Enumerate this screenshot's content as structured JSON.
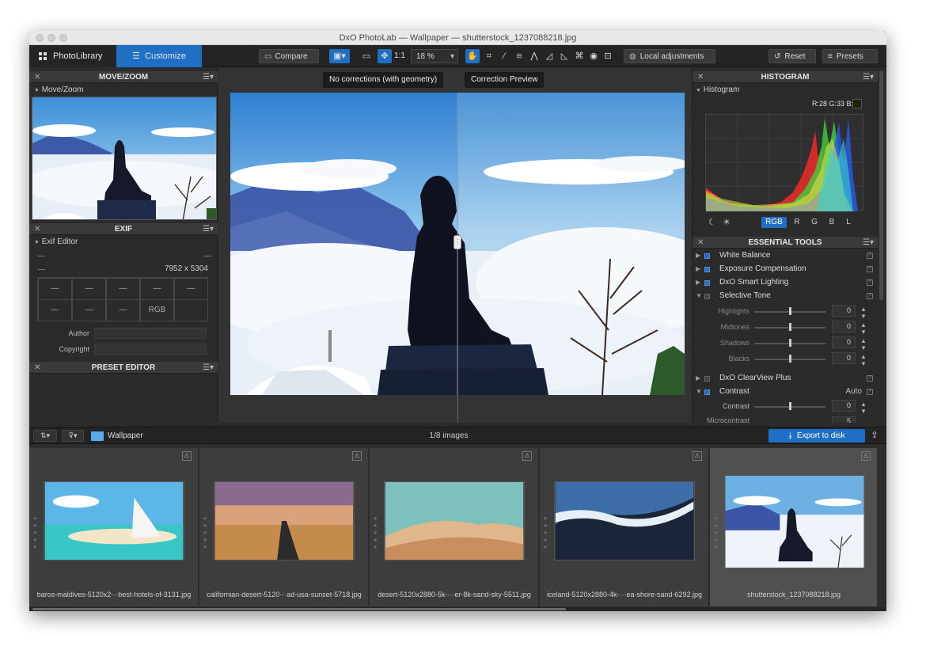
{
  "window": {
    "title": "DxO PhotoLab — Wallpaper — shutterstock_1237088218.jpg"
  },
  "tabs": [
    {
      "label": "PhotoLibrary"
    },
    {
      "label": "Customize"
    }
  ],
  "toolbar": {
    "compare_label": "Compare",
    "zoom_1to1": "1:1",
    "zoom_level": "18 %",
    "local_adjustments_label": "Local adjustments",
    "reset_label": "Reset",
    "presets_label": "Presets"
  },
  "left": {
    "movezoom": {
      "title": "MOVE/ZOOM",
      "sub": "Move/Zoom"
    },
    "exif": {
      "title": "EXIF",
      "sub": "Exif Editor",
      "dash": "—",
      "dimensions": "7952 x 5304",
      "cells": [
        "—",
        "—",
        "—",
        "—",
        "—",
        "—",
        "—",
        "—",
        "RGB",
        ""
      ],
      "author_label": "Author",
      "copyright_label": "Copyright"
    },
    "preset_editor": {
      "title": "PRESET EDITOR"
    }
  },
  "viewer": {
    "left_label": "No corrections (with geometry)",
    "right_label": "Correction Preview"
  },
  "right": {
    "histogram": {
      "title": "HISTOGRAM",
      "sub": "Histogram",
      "readout": "R:28 G:33 B:8",
      "channels": [
        "RGB",
        "R",
        "G",
        "B",
        "L"
      ]
    },
    "tools": {
      "title": "ESSENTIAL TOOLS",
      "items": [
        {
          "label": "White Balance"
        },
        {
          "label": "Exposure Compensation"
        },
        {
          "label": "DxO Smart Lighting"
        },
        {
          "label": "Selective Tone"
        },
        {
          "label": "DxO ClearView Plus"
        },
        {
          "label": "Contrast",
          "extra": "Auto"
        }
      ],
      "selective_tone": [
        {
          "label": "Highlights",
          "value": "0"
        },
        {
          "label": "Midtones",
          "value": "0"
        },
        {
          "label": "Shadows",
          "value": "0"
        },
        {
          "label": "Blacks",
          "value": "0"
        }
      ],
      "contrast_slider": {
        "label": "Contrast",
        "value": "0"
      },
      "micro_label": "Microcontrast",
      "micro_value": "5"
    }
  },
  "filmstrip": {
    "folder": "Wallpaper",
    "count": "1/8 images",
    "export_label": "Export to disk",
    "thumbs": [
      {
        "name": "baros-maldives-5120x2···best-hotels-of-3131.jpg"
      },
      {
        "name": "californian-desert-5120···ad-usa-sunset-5718.jpg"
      },
      {
        "name": "desert-5120x2880-5k-···er-8k-sand-sky-5511.jpg"
      },
      {
        "name": "iceland-5120x2880-4k-···ea-shore-sand-6292.jpg"
      },
      {
        "name": "shutterstock_1237088218.jpg"
      }
    ]
  },
  "colors": {
    "accent": "#1f6fc5",
    "panel": "#2b2b2b",
    "header": "#3a3a3a"
  }
}
